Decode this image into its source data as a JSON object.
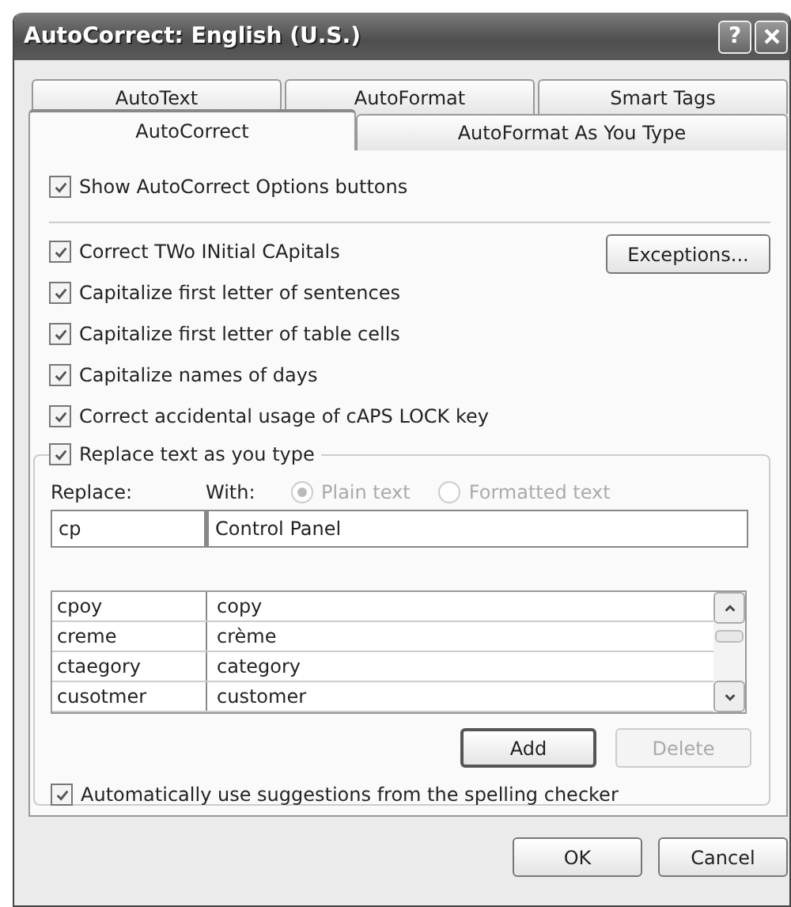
{
  "window": {
    "title": "AutoCorrect: English (U.S.)",
    "help_button": "?"
  },
  "tab_rows": [
    {
      "tabs": [
        {
          "label": "AutoText",
          "selected": false
        },
        {
          "label": "AutoFormat",
          "selected": false
        },
        {
          "label": "Smart Tags",
          "selected": false
        }
      ]
    },
    {
      "tabs": [
        {
          "label": "AutoCorrect",
          "selected": true
        },
        {
          "label": "AutoFormat As You Type",
          "selected": false
        }
      ]
    }
  ],
  "show_options": {
    "label": "Show AutoCorrect Options buttons",
    "checked": true
  },
  "exceptions_button": "Exceptions...",
  "options": [
    {
      "label": "Correct TWo INitial CApitals",
      "checked": true
    },
    {
      "label": "Capitalize first letter of sentences",
      "checked": true
    },
    {
      "label": "Capitalize first letter of table cells",
      "checked": true
    },
    {
      "label": "Capitalize names of days",
      "checked": true
    },
    {
      "label": "Correct accidental usage of cAPS LOCK key",
      "checked": true
    }
  ],
  "replace_group": {
    "label": "Replace text as you type",
    "checked": true,
    "replace_label": "Replace:",
    "with_label": "With:",
    "formats": [
      {
        "label": "Plain text",
        "selected": true,
        "disabled": true
      },
      {
        "label": "Formatted text",
        "selected": false,
        "disabled": true
      }
    ],
    "replace_value": "cp",
    "with_value": "Control Panel",
    "entries": [
      {
        "replace": "cpoy",
        "with": "copy"
      },
      {
        "replace": "creme",
        "with": "crème"
      },
      {
        "replace": "ctaegory",
        "with": "category"
      },
      {
        "replace": "cusotmer",
        "with": "customer"
      }
    ],
    "add_button": {
      "label": "Add",
      "disabled": false
    },
    "delete_button": {
      "label": "Delete",
      "disabled": true
    },
    "suggestions": {
      "label": "Automatically use suggestions from the spelling checker",
      "checked": true
    }
  },
  "buttons": [
    "OK",
    "Cancel"
  ]
}
